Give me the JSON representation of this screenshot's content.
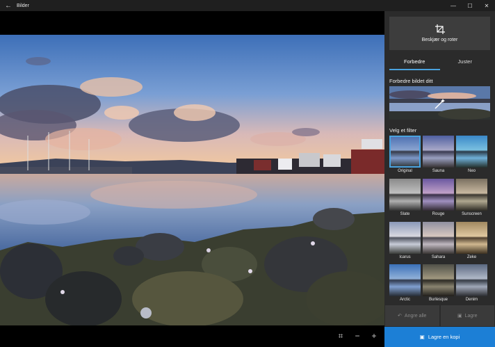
{
  "titlebar": {
    "title": "Bilder",
    "back_icon": "back-arrow-icon",
    "minimize": "—",
    "maximize": "☐",
    "close": "✕"
  },
  "panel": {
    "crop_label": "Beskjær og roter",
    "tabs": [
      {
        "label": "Forbedre",
        "active": true
      },
      {
        "label": "Juster",
        "active": false
      }
    ],
    "enhance_title": "Forbedre bildet ditt",
    "filter_title": "Velg et filter",
    "filters": [
      {
        "label": "Original",
        "selected": true
      },
      {
        "label": "Sauna",
        "selected": false
      },
      {
        "label": "Neo",
        "selected": false
      },
      {
        "label": "Slate",
        "selected": false
      },
      {
        "label": "Rouge",
        "selected": false
      },
      {
        "label": "Sunscreen",
        "selected": false
      },
      {
        "label": "Icarus",
        "selected": false
      },
      {
        "label": "Sahara",
        "selected": false
      },
      {
        "label": "Zeke",
        "selected": false
      },
      {
        "label": "Arctic",
        "selected": false
      },
      {
        "label": "Burlesque",
        "selected": false
      },
      {
        "label": "Denim",
        "selected": false
      }
    ],
    "undo_label": "Angre alle",
    "save_label": "Lagre",
    "save_copy_label": "Lagre en kopi"
  },
  "colors": {
    "accent": "#1c7fd6",
    "panel_bg": "#2b2b2b",
    "button_bg": "#3d3d3d"
  }
}
